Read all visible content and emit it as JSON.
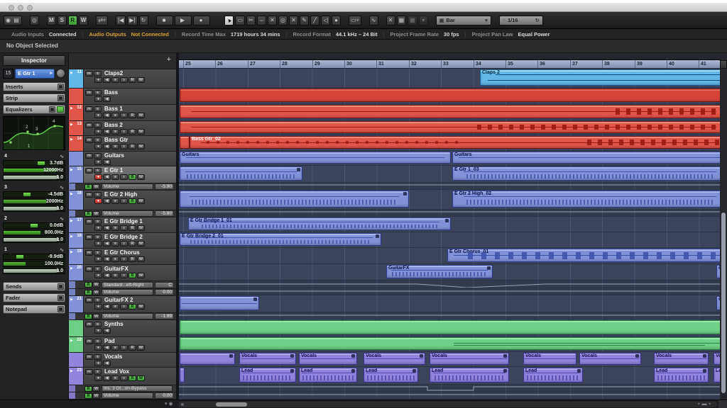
{
  "info_line": "No Object Selected",
  "window": {
    "controls": [
      "close",
      "minimize",
      "zoom"
    ]
  },
  "icons": {
    "activate": "◉",
    "setup": "▤",
    "constrain": "◎",
    "autoscroll": "⇄",
    "dropdown": "▾",
    "go-start": "|◀",
    "go-end": "▶|",
    "cycle": "↻",
    "stop": "■",
    "play": "▶",
    "record": "●",
    "pointer": "▲",
    "range": "▭",
    "split": "✂",
    "glue": "⌣",
    "erase": "✕",
    "zoom": "◎",
    "mute": "✕",
    "draw": "✎",
    "line": "╱",
    "audition": "◁",
    "color": "●",
    "sizing": "▭",
    "crossfade": "∿",
    "snap": "✕",
    "grid": "▦",
    "quantize-circle": "○",
    "iterative": "↻",
    "monitor": "◀",
    "edit": "e",
    "inserts": "≡",
    "rec-dot": "●",
    "band-curve": "∿",
    "bar-icon": "▣"
  },
  "toolbar": {
    "track_states": [
      "M",
      "S",
      "R",
      "W"
    ],
    "active_state": "R",
    "grid_type": "Bar",
    "quantize_value": "1/16"
  },
  "status_bar": {
    "items": [
      {
        "label": "Audio Inputs",
        "value": "Connected",
        "alert": false
      },
      {
        "label": "Audio Outputs",
        "value": "Not Connected",
        "alert": true
      },
      {
        "label": "Record Time Max",
        "value": "1719 hours 34 mins",
        "alert": false
      },
      {
        "label": "Record Format",
        "value": "44.1 kHz – 24 Bit",
        "alert": false
      },
      {
        "label": "Project Frame Rate",
        "value": "30 fps",
        "alert": false
      },
      {
        "label": "Project Pan Law",
        "value": "Equal Power",
        "alert": false
      }
    ]
  },
  "inspector": {
    "title": "Inspector",
    "track_number": "15",
    "track_name": "E Gtr 1",
    "sections": [
      "Inserts",
      "Strip",
      "Equalizers"
    ],
    "bottom_sections": [
      "Sends",
      "Fader",
      "Notepad"
    ],
    "eq_bands": [
      {
        "num": "4",
        "gain": "3.7dB",
        "freq": "12000Hz",
        "q": "1.0",
        "gain_pct": 62,
        "freq_pct": 86
      },
      {
        "num": "3",
        "gain": "-4.5dB",
        "freq": "2000Hz",
        "q": "1.0",
        "gain_pct": 38,
        "freq_pct": 70
      },
      {
        "num": "2",
        "gain": "0.0dB",
        "freq": "800.0Hz",
        "q": "1.0",
        "gain_pct": 50,
        "freq_pct": 60
      },
      {
        "num": "1",
        "gain": "-9.9dB",
        "freq": "100.0Hz",
        "q": "1.0",
        "gain_pct": 27,
        "freq_pct": 36
      }
    ]
  },
  "track_list": {
    "add_label": "+"
  },
  "ruler": {
    "bars": [
      25,
      26,
      27,
      28,
      29,
      30,
      31,
      32,
      33,
      34,
      35,
      36,
      37,
      38,
      39,
      40,
      41
    ]
  },
  "colors": {
    "families": {
      "lightblue": {
        "bo": "#62b7e8",
        "bd": "#135e90",
        "wv": "#0f517c",
        "lb": "#06283d",
        "lt": "#a9ddf5"
      },
      "red": {
        "bo": "#e25549",
        "bd": "#7c120c",
        "wv": "#9b1a10",
        "lb": "#ffffff",
        "lt": "#ef8a7f"
      },
      "redfolder": {
        "bo": "#d64438",
        "bd": "#7c120c",
        "wv": "#9b1a10",
        "lb": "#ffffff",
        "lt": "#e56a5e"
      },
      "blue": {
        "bo": "#8391d8",
        "bd": "#2b3a8e",
        "wv": "#3c4ea8",
        "lb": "#0a1148",
        "lt": "#abb7ea"
      },
      "green": {
        "bo": "#6ecf86",
        "bd": "#237c3c",
        "wv": "#2f9752",
        "lb": "#063918",
        "lt": "#a0e2b0"
      },
      "purple": {
        "bo": "#9184dc",
        "bd": "#39309a",
        "wv": "#4d41ad",
        "lb": "#140c50",
        "lt": "#b4aaec"
      }
    }
  },
  "rows": [
    {
      "kind": "audio",
      "num": "11",
      "name": "Claps2",
      "family": "lightblue",
      "h": 27,
      "clips": [
        {
          "label": "Claps 2",
          "start": 34.2,
          "end": 41.9,
          "wave": "autolines"
        }
      ]
    },
    {
      "kind": "folder",
      "name": "Bass",
      "family": "red",
      "clipfamily": "redfolder",
      "h": 23,
      "clips": [
        {
          "start": 24.9,
          "end": 41.9
        }
      ]
    },
    {
      "kind": "audio",
      "num": "12",
      "name": "Bass 1",
      "family": "red",
      "h": 23,
      "clips": [
        {
          "start": 24.9,
          "end": 41.9,
          "wave": "line",
          "dense_from": 38.4
        }
      ]
    },
    {
      "kind": "audio",
      "num": "13",
      "name": "Bass 2",
      "family": "red",
      "h": 21,
      "clips": [
        {
          "start": 24.9,
          "end": 41.9,
          "wave": "line",
          "dense_from": 34.1
        }
      ]
    },
    {
      "kind": "audio",
      "num": "14",
      "name": "Bass Gtr",
      "family": "red",
      "h": 22,
      "clips": [
        {
          "start": 24.9,
          "end": 25.2
        },
        {
          "label": "Bass Gtr_02",
          "start": 25.2,
          "end": 41.9,
          "wave": "dots",
          "dense_from": 37.5
        }
      ]
    },
    {
      "kind": "folder",
      "name": "Guitars",
      "family": "blue",
      "h": 21,
      "clips": [
        {
          "label": "Guitars",
          "start": 24.9,
          "end": 33.3,
          "wave": "line"
        },
        {
          "label": "Guitars",
          "start": 33.35,
          "end": 41.9,
          "wave": "line"
        }
      ]
    },
    {
      "kind": "audio",
      "num": "15",
      "name": "E Gtr 1",
      "family": "blue",
      "h": 24,
      "sel": true,
      "rec": true,
      "r_on": true,
      "clips": [
        {
          "start": 24.9,
          "end": 28.7,
          "lock": true,
          "wave": "squiggle"
        },
        {
          "label": "E Gtr 1_03",
          "start": 33.35,
          "end": 41.9,
          "wave": "squiggle"
        }
      ]
    },
    {
      "kind": "lane",
      "family": "blue",
      "label": "Volume",
      "value": "-5.90",
      "h": 10,
      "poly": [
        [
          0,
          3
        ],
        [
          762,
          3
        ]
      ]
    },
    {
      "kind": "audio",
      "num": "16",
      "name": "E Gtr 2 High",
      "family": "blue",
      "h": 28,
      "rec": true,
      "r_on": true,
      "clips": [
        {
          "start": 24.9,
          "end": 32.0,
          "lock": true,
          "wave": "squiggle"
        },
        {
          "label": "E Gtr 2 High_02",
          "start": 33.35,
          "end": 41.9,
          "wave": "squiggle"
        }
      ]
    },
    {
      "kind": "lane",
      "family": "blue",
      "label": "Volume",
      "value": "-5.80",
      "h": 10,
      "poly": [
        [
          0,
          3
        ],
        [
          762,
          3
        ]
      ]
    },
    {
      "kind": "audio",
      "num": "17",
      "name": "E Gtr Bridge 1",
      "family": "blue",
      "h": 22,
      "clips": [
        {
          "label": "E Gtr Bridge 1_01",
          "start": 25.15,
          "end": 33.3,
          "lock": true,
          "wave": "squiggle"
        }
      ]
    },
    {
      "kind": "audio",
      "num": "18",
      "name": "E Gtr Bridge 2",
      "family": "blue",
      "h": 22,
      "clips": [
        {
          "label": "E Gtr Bridge 2_01",
          "start": 24.9,
          "end": 31.15,
          "lock": true,
          "wave": "squiggle"
        }
      ]
    },
    {
      "kind": "audio",
      "num": "19",
      "name": "E Gtr Chorus",
      "family": "blue",
      "h": 23,
      "clips": [
        {
          "label": "E Gtr Chorus_01",
          "start": 33.2,
          "end": 41.9,
          "wave": "bursts"
        }
      ]
    },
    {
      "kind": "audio",
      "num": "20",
      "name": "GuitarFX",
      "family": "blue",
      "h": 23,
      "r_on": true,
      "clips": [
        {
          "label": "GuitarFX",
          "start": 31.3,
          "end": 34.6,
          "lock": true,
          "wave": "squiggle"
        },
        {
          "label": "Guit",
          "start": 41.55,
          "end": 41.9
        }
      ]
    },
    {
      "kind": "lane",
      "family": "blue",
      "label": "Standard...eft-Right",
      "value": "C",
      "h": 11,
      "poly": [
        [
          0,
          5
        ],
        [
          336,
          5
        ],
        [
          406,
          10
        ],
        [
          516,
          5
        ],
        [
          762,
          5
        ]
      ]
    },
    {
      "kind": "lane",
      "family": "blue",
      "label": "Volume",
      "value": "0.00",
      "h": 10,
      "poly": [
        [
          0,
          4
        ],
        [
          762,
          4
        ]
      ]
    },
    {
      "kind": "audio",
      "num": "21",
      "name": "GuitarFX 2",
      "family": "blue",
      "h": 24,
      "r_on": true,
      "clips": [
        {
          "start": 24.9,
          "end": 27.35,
          "lock": true,
          "wave": "line"
        },
        {
          "label": "G",
          "start": 41.55,
          "end": 41.9
        }
      ]
    },
    {
      "kind": "lane",
      "family": "blue",
      "label": "Volume",
      "value": "-1.99",
      "h": 10,
      "poly": [
        [
          0,
          4
        ],
        [
          762,
          4
        ]
      ]
    },
    {
      "kind": "folder",
      "name": "Synths",
      "family": "green",
      "h": 24,
      "clips": [
        {
          "start": 24.9,
          "end": 41.9
        }
      ]
    },
    {
      "kind": "audio",
      "num": "22",
      "name": "Pad",
      "family": "green",
      "h": 22,
      "clips": [
        {
          "start": 24.9,
          "end": 41.9,
          "wave": "padlines"
        }
      ]
    },
    {
      "kind": "folder",
      "name": "Vocals",
      "family": "purple",
      "h": 21,
      "clips": [
        {
          "start": 24.9,
          "end": 26.6,
          "lock": true
        },
        {
          "label": "Vocals",
          "start": 26.75,
          "end": 28.5,
          "lock": true,
          "wave": "line"
        },
        {
          "label": "Vocals",
          "start": 28.6,
          "end": 30.4,
          "lock": true,
          "wave": "line"
        },
        {
          "label": "Vocals",
          "start": 30.6,
          "end": 32.5,
          "lock": true,
          "wave": "line"
        },
        {
          "label": "Vocals",
          "start": 32.65,
          "end": 35.1,
          "lock": true,
          "wave": "line"
        },
        {
          "label": "Vocals",
          "start": 35.55,
          "end": 37.2,
          "wave": "line"
        },
        {
          "label": "Vocals",
          "start": 37.3,
          "end": 39.2,
          "lock": true,
          "wave": "line"
        },
        {
          "label": "Vocals",
          "start": 39.6,
          "end": 41.3,
          "lock": true,
          "wave": "line"
        },
        {
          "label": "Vo",
          "start": 41.45,
          "end": 41.9
        }
      ]
    },
    {
      "kind": "audio",
      "num": "23",
      "name": "Lead Vox",
      "family": "purple",
      "h": 25,
      "r_on": true,
      "w_on": true,
      "clips": [
        {
          "start": 24.9,
          "end": 25.05
        },
        {
          "label": "Lead",
          "start": 26.75,
          "end": 28.5,
          "lock": true,
          "wave": "squiggle"
        },
        {
          "label": "Lead",
          "start": 28.6,
          "end": 30.4,
          "lock": true,
          "wave": "squiggle"
        },
        {
          "label": "Lead",
          "start": 30.6,
          "end": 32.3,
          "lock": true,
          "wave": "squiggle"
        },
        {
          "label": "Lead",
          "start": 32.65,
          "end": 35.1,
          "lock": true,
          "wave": "squiggle"
        },
        {
          "label": "Lead",
          "start": 35.55,
          "end": 37.4,
          "lock": true,
          "wave": "squiggle"
        },
        {
          "label": "Lead",
          "start": 39.6,
          "end": 41.3,
          "lock": true,
          "wave": "squiggle"
        },
        {
          "label": "Le",
          "start": 41.45,
          "end": 41.9
        }
      ]
    },
    {
      "kind": "lane",
      "family": "purple",
      "label": "Ins. 3 Dt...on-Bypass",
      "value": null,
      "h": 10,
      "poly": [
        [
          0,
          3
        ],
        [
          350,
          3
        ],
        [
          350,
          8
        ],
        [
          415,
          8
        ],
        [
          415,
          3
        ],
        [
          762,
          3
        ]
      ]
    },
    {
      "kind": "lane",
      "family": "purple",
      "label": "Volume",
      "value": "0.00",
      "h": 10,
      "poly": [
        [
          0,
          4
        ],
        [
          762,
          4
        ]
      ]
    }
  ]
}
